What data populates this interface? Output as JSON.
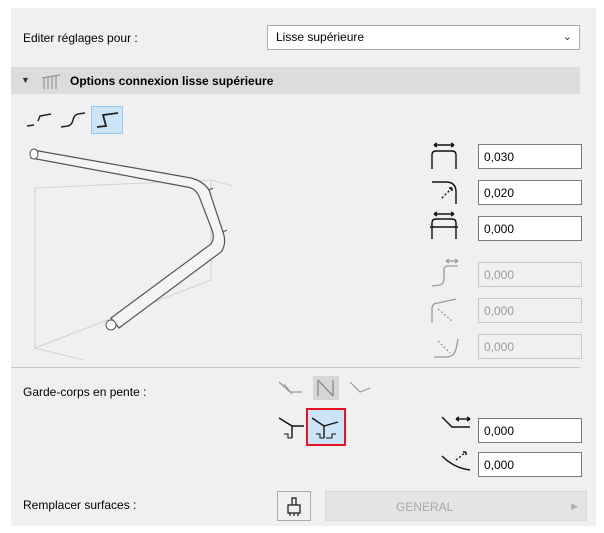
{
  "edit_settings": {
    "label": "Editer réglages pour :",
    "selected": "Lisse supérieure"
  },
  "section": {
    "title": "Options connexion lisse supérieure",
    "expanded": true
  },
  "connection_types": [
    "angled-connection",
    "curved-connection",
    "stepped-connection"
  ],
  "selected_connection": "stepped-connection",
  "fields": [
    {
      "icon": "horizontal-extension-icon",
      "value": "0,030",
      "enabled": true
    },
    {
      "icon": "corner-radius-icon",
      "value": "0,020",
      "enabled": true
    },
    {
      "icon": "vertical-offset-icon",
      "value": "0,000",
      "enabled": true
    },
    {
      "icon": "curve-extension-icon",
      "value": "0,000",
      "enabled": false
    },
    {
      "icon": "curve-radius-icon",
      "value": "0,000",
      "enabled": false
    },
    {
      "icon": "curve-offset-icon",
      "value": "0,000",
      "enabled": false
    }
  ],
  "slope": {
    "label": "Garde-corps en pente :",
    "fields": [
      {
        "icon": "slope-horizontal-icon",
        "value": "0,000"
      },
      {
        "icon": "slope-radius-icon",
        "value": "0,000"
      }
    ]
  },
  "override": {
    "label": "Remplacer surfaces :",
    "surface": "GENERAL"
  },
  "colors": {
    "selection": "#cce4f7",
    "highlight": "#e81123",
    "panel": "#f0f0f0"
  }
}
